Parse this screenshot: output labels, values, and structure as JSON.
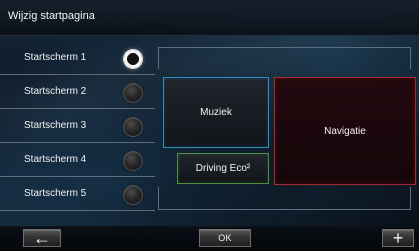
{
  "header": {
    "title": "Wijzig startpagina"
  },
  "sidebar": {
    "items": [
      {
        "label": "Startscherm 1"
      },
      {
        "label": "Startscherm 2"
      },
      {
        "label": "Startscherm 3"
      },
      {
        "label": "Startscherm 4"
      },
      {
        "label": "Startscherm 5"
      }
    ]
  },
  "preview": {
    "tiles": {
      "muziek": "Muziek",
      "navigatie": "Navigatie",
      "driving_eco": "Driving Eco²"
    }
  },
  "footer": {
    "back_icon": "←",
    "ok_label": "OK",
    "add_icon": "+"
  },
  "icons": {
    "back": "arrow-left-icon",
    "add": "plus-icon"
  },
  "colors": {
    "muziek_border": "#2f8fbb",
    "navigatie_border": "#a52933",
    "driving_eco_border": "#4d8f3f"
  }
}
